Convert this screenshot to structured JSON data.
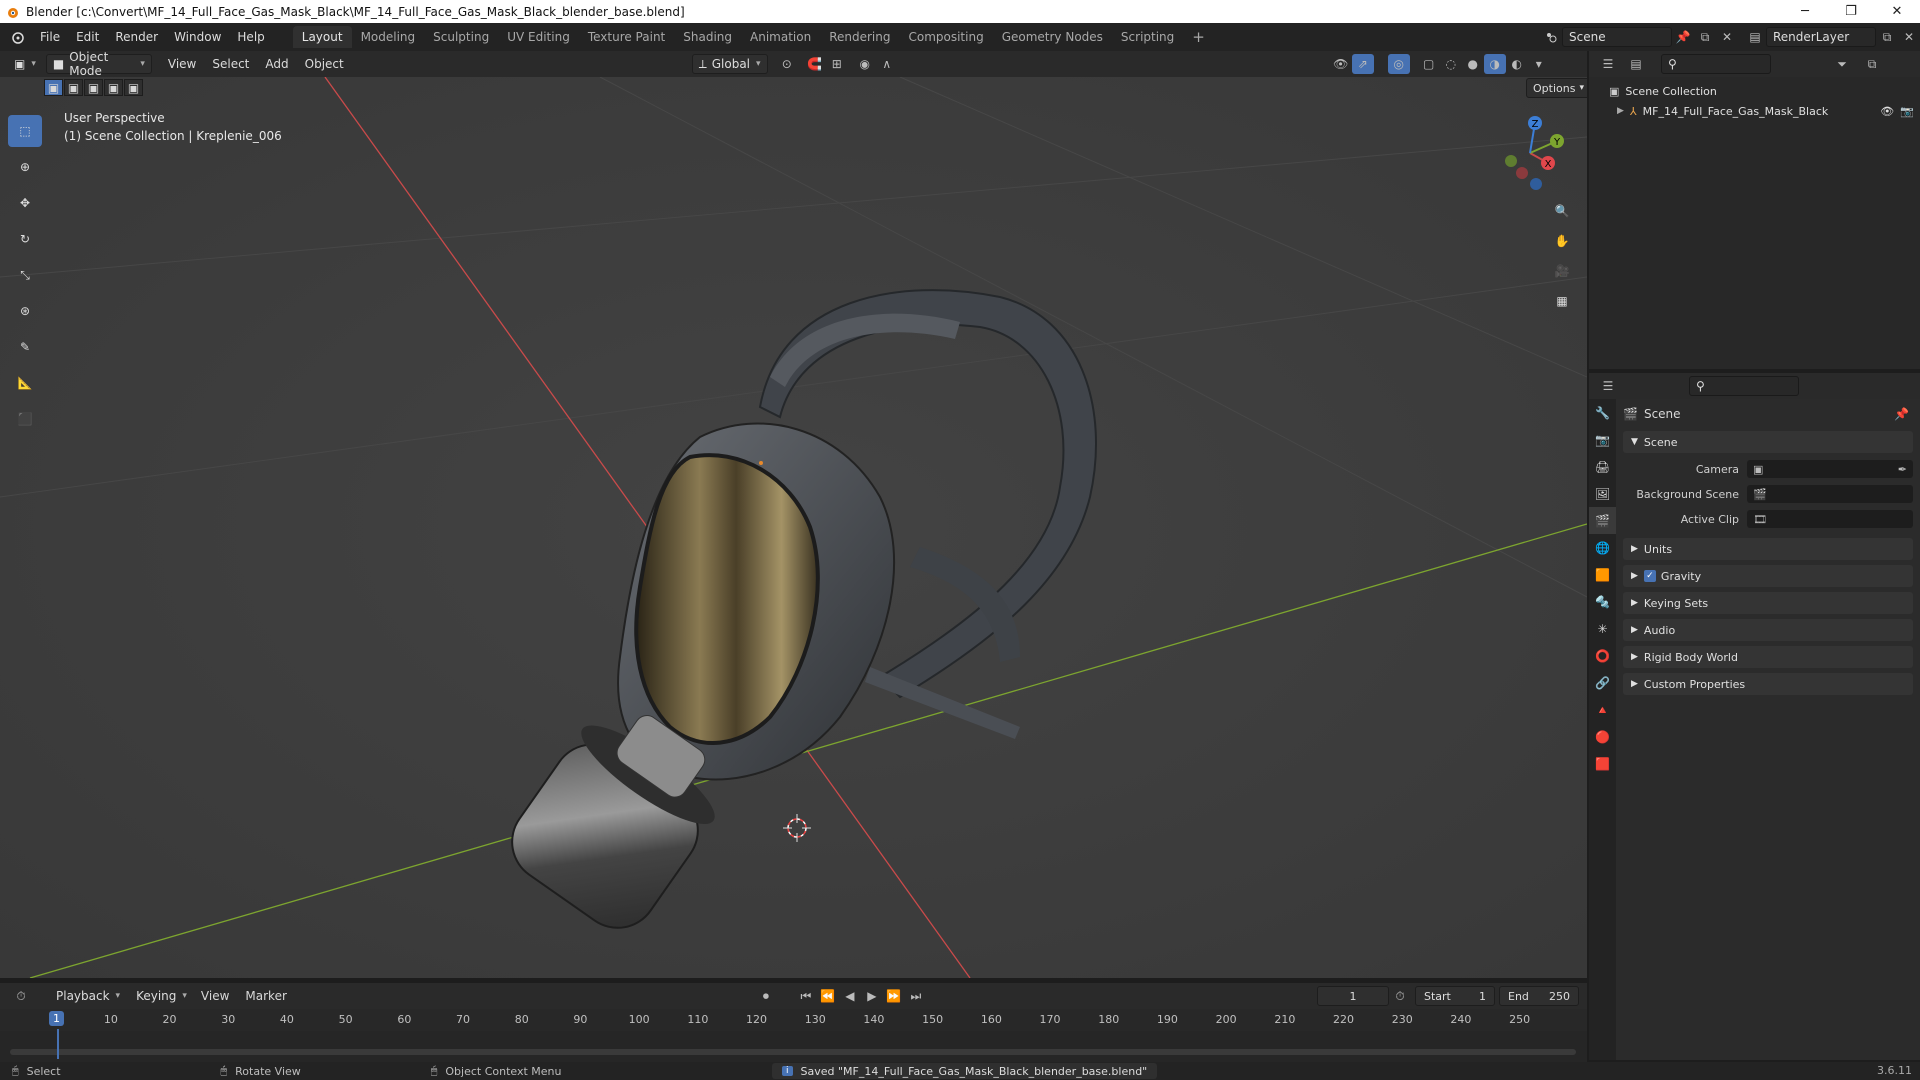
{
  "window": {
    "title": "Blender [c:\\Convert\\MF_14_Full_Face_Gas_Mask_Black\\MF_14_Full_Face_Gas_Mask_Black_blender_base.blend]",
    "controls": [
      "─",
      "❐",
      "✕"
    ]
  },
  "menu": [
    "File",
    "Edit",
    "Render",
    "Window",
    "Help"
  ],
  "workspaces": [
    "Layout",
    "Modeling",
    "Sculpting",
    "UV Editing",
    "Texture Paint",
    "Shading",
    "Animation",
    "Rendering",
    "Compositing",
    "Geometry Nodes",
    "Scripting"
  ],
  "active_workspace": "Layout",
  "add_workspace": "+",
  "scene_selector": "Scene",
  "renderlayer_selector": "RenderLayer",
  "viewport_header": {
    "mode": "Object Mode",
    "menus": [
      "View",
      "Select",
      "Add",
      "Object"
    ],
    "orientation": "Global",
    "options": "Options"
  },
  "viewport": {
    "perspective": "User Perspective",
    "collection": "(1) Scene Collection | Kreplenie_006",
    "gizmo_axes": [
      "X",
      "Y",
      "Z"
    ]
  },
  "outliner": {
    "root": "Scene Collection",
    "items": [
      "MF_14_Full_Face_Gas_Mask_Black"
    ]
  },
  "properties": {
    "header": "Scene",
    "scene_section": "Scene",
    "fields": [
      {
        "label": "Camera",
        "value": ""
      },
      {
        "label": "Background Scene",
        "value": ""
      },
      {
        "label": "Active Clip",
        "value": ""
      }
    ],
    "sections": [
      "Units",
      "Gravity",
      "Keying Sets",
      "Audio",
      "Rigid Body World",
      "Custom Properties"
    ],
    "gravity_enabled": true
  },
  "timeline": {
    "menus": [
      "Playback",
      "Keying",
      "View",
      "Marker"
    ],
    "current_frame": "1",
    "start_label": "Start",
    "start": "1",
    "end_label": "End",
    "end": "250",
    "ticks": [
      "1",
      "10",
      "20",
      "30",
      "40",
      "50",
      "60",
      "70",
      "80",
      "90",
      "100",
      "110",
      "120",
      "130",
      "140",
      "150",
      "160",
      "170",
      "180",
      "190",
      "200",
      "210",
      "220",
      "230",
      "240",
      "250"
    ]
  },
  "statusbar": {
    "select": "Select",
    "rotate": "Rotate View",
    "context": "Object Context Menu",
    "message": "Saved \"MF_14_Full_Face_Gas_Mask_Black_blender_base.blend\"",
    "version": "3.6.11"
  },
  "colors": {
    "accent": "#4772b3",
    "x_axis": "#c94a4a",
    "y_axis": "#7da52f",
    "z_axis": "#3c7ed6"
  }
}
